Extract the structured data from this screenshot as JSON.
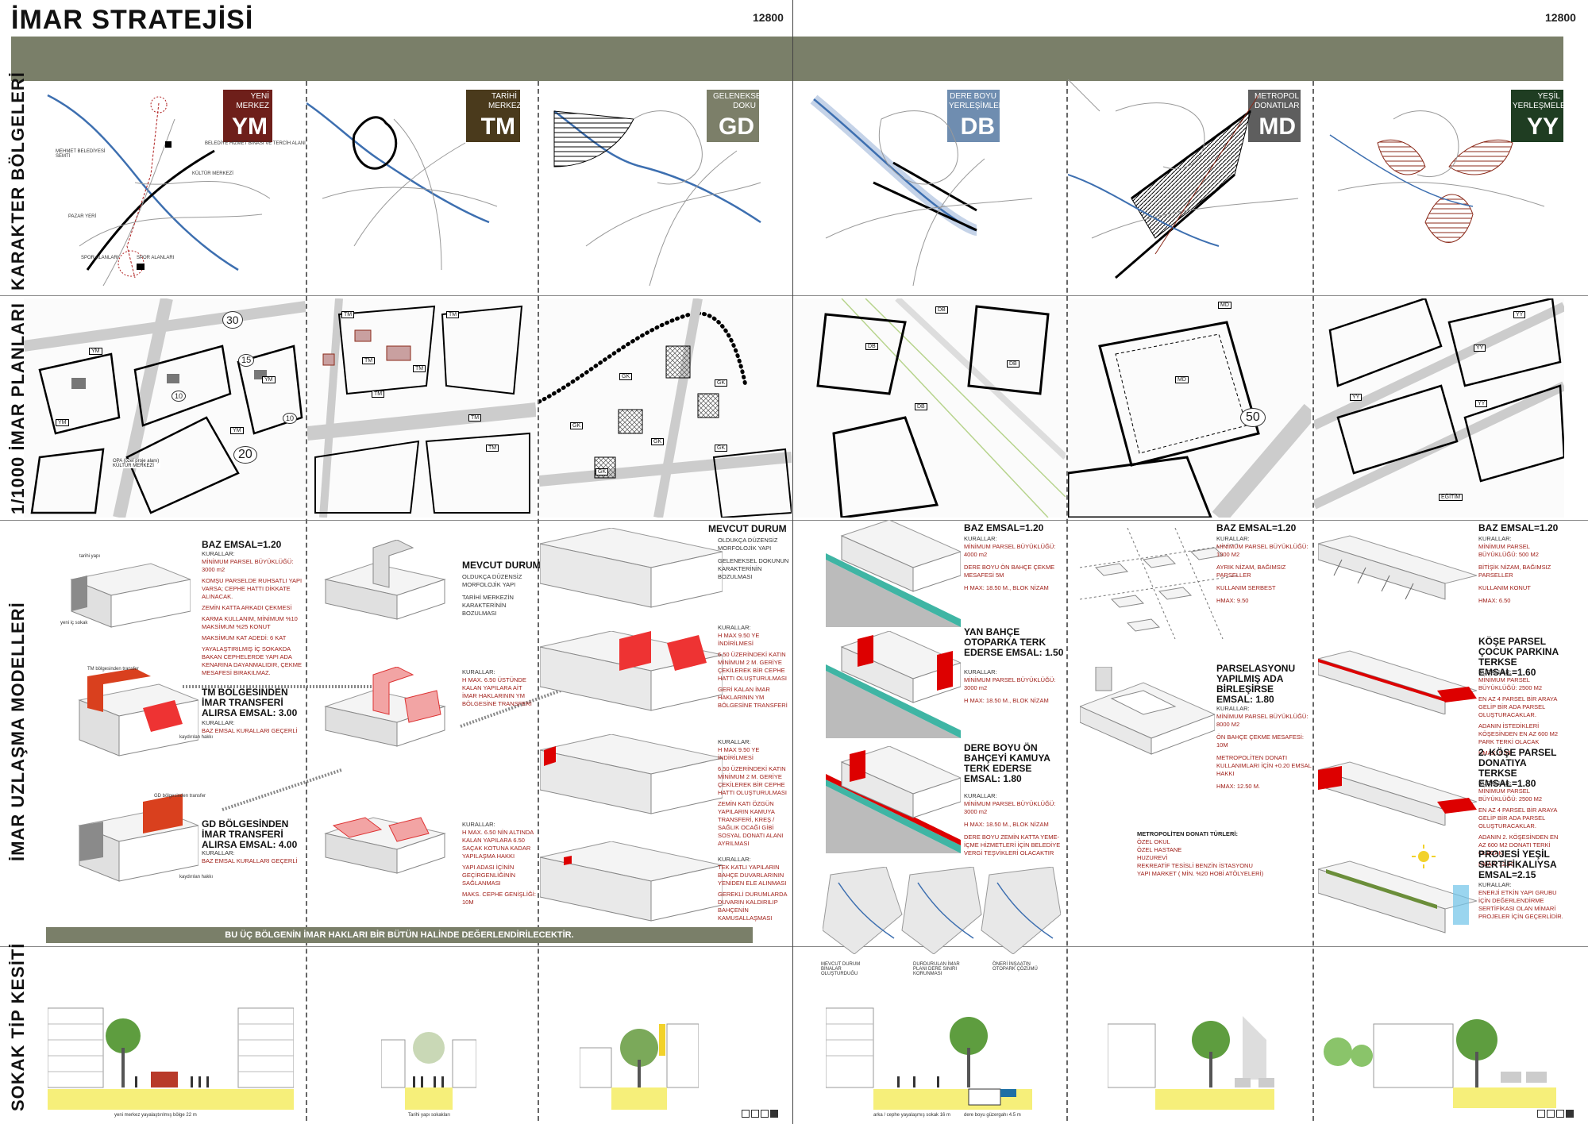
{
  "title": "İMAR STRATEJİSİ",
  "sheet_numbers": [
    "12800",
    "12800"
  ],
  "rows": {
    "r1": "KARAKTER BÖLGELERİ",
    "r2": "1/1000 İMAR PLANLARI",
    "r3": "İMAR UZLAŞMA MODELLERİ",
    "r4": "SOKAK TİP KESİTİ"
  },
  "zones": [
    {
      "small": "YENİ MERKEZ",
      "code": "YM",
      "color": "#6e1f1a"
    },
    {
      "small": "TARİHİ MERKEZ",
      "code": "TM",
      "color": "#4a3a1c"
    },
    {
      "small": "GELENEKSEL DOKU",
      "code": "GD",
      "color": "#7c7f69"
    },
    {
      "small": "DERE BOYU YERLEŞİMLER",
      "code": "DB",
      "color": "#6f8db0"
    },
    {
      "small": "METROPOL DONATILAR",
      "code": "MD",
      "color": "#5e5e5e"
    },
    {
      "small": "YEŞİL YERLEŞMELER",
      "code": "YY",
      "color": "#1f3d22"
    }
  ],
  "ym_map_notes": [
    "BELEDİYE HİZMET BİNASI VE TERCİH ALANI",
    "MEHMET BELEDİYESİ SEMTİ",
    "KÜLTÜR MERKEZİ",
    "PAZAR YERİ",
    "SPOR ALANLARI",
    "SPOR ALANLARI"
  ],
  "plan_labels": {
    "c1": [
      "YM",
      "YM",
      "YM",
      "YM",
      "30",
      "15",
      "10",
      "10",
      "20",
      "OPA (özel proje alanı) KÜLTÜR MERKEZİ"
    ],
    "c2": [
      "TM",
      "TM",
      "TM",
      "TM",
      "TM",
      "TM",
      "TM"
    ],
    "c3": [
      "GK",
      "GK",
      "GK",
      "GK",
      "GK",
      "GK"
    ],
    "c4": [
      "DB",
      "DB",
      "DB",
      "DB"
    ],
    "c5": [
      "MD",
      "MD",
      "50"
    ],
    "c6": [
      "YY",
      "YY",
      "YY",
      "YY",
      "EĞİTİM"
    ]
  },
  "ym": {
    "h1": "BAZ EMSAL=1.20",
    "k1": [
      "KURALLAR:",
      "MİNİMUM PARSEL BÜYÜKLÜĞÜ: 3000 m2",
      "KOMŞU PARSELDE RUHSATLI YAPI VARSA; CEPHE HATTI DİKKATE ALINACAK.",
      "ZEMİN KATTA ARKADI ÇEKMESİ",
      "KARMA KULLANIM, MİNİMUM %10 MAKSİMUM %25 KONUT",
      "MAKSİMUM KAT ADEDİ: 6 KAT",
      "YAYALAŞTIRILMIŞ İÇ SOKAKDA BAKAN CEPHELERDE YAPI ADA KENARINA DAYANMALIDIR, ÇEKME MESAFESİ BIRAKILMAZ."
    ],
    "h2": "TM BÖLGESİNDEN İMAR TRANSFERİ ALIRSA EMSAL: 3.00",
    "k2": [
      "KURALLAR:",
      "BAZ EMSAL KURALLARI GEÇERLİ"
    ],
    "h3": "GD BÖLGESİNDEN İMAR TRANSFERİ ALIRSA EMSAL: 4.00",
    "k3": [
      "KURALLAR:",
      "BAZ EMSAL KURALLARI GEÇERLİ"
    ],
    "notes": [
      "tarihi yapı",
      "yeni iç sokak",
      "TM bölgesinden transfer",
      "kaydırılan hakkı",
      "GD bölgesinden transfer",
      "kaydırılan hakkı"
    ]
  },
  "tm": {
    "h1": "MEVCUT DURUM",
    "k1": [
      "OLDUKÇA DÜZENSİZ MORFOLOJİK YAPI",
      "TARİHİ MERKEZİN KARAKTERİNİN BOZULMASI"
    ],
    "k2": [
      "KURALLAR:",
      "H MAX. 6.50 ÜSTÜNDE KALAN YAPILARA AİT İMAR HAKLARININ YM BÖLGESİNE TRANSFERİ"
    ],
    "k3": [
      "KURALLAR:",
      "H MAX. 6.50 NİN ALTINDA KALAN YAPILARA 6.50 SAÇAK KOTUNA KADAR YAPILAŞMA HAKKI",
      "YAPI ADASI İÇİNİN GEÇİRGENLİĞİNİN SAĞLANMASI",
      "MAKS. CEPHE GENİŞLİĞİ: 10M"
    ]
  },
  "gd": {
    "h1": "MEVCUT DURUM",
    "k1": [
      "OLDUKÇA DÜZENSİZ MORFOLOJİK YAPI",
      "GELENEKSEL DOKUNUN KARAKTERİNİN BOZULMASI"
    ],
    "k2": [
      "KURALLAR:",
      "H MAX 9.50 YE İNDİRİLMESİ",
      "6.50 ÜZERİNDEKİ KATIN MİNİMUM 2 M. GERİYE ÇEKİLEREK BİR CEPHE HATTI OLUŞTURULMASI",
      "GERİ KALAN İMAR HAKLARININ YM BÖLGESİNE TRANSFERİ"
    ],
    "k3": [
      "KURALLAR:",
      "H MAX 9.50 YE İNDİRİLMESİ",
      "6.50 ÜZERİNDEKİ KATIN MİNİMUM 2 M. GERİYE ÇEKİLEREK BİR CEPHE HATTI OLUŞTURULMASI",
      "ZEMİN KATI ÖZGÜN YAPILARIN KAMUYA TRANSFERİ, KREŞ / SAĞLIK OCAĞI GİBİ SOSYAL DONATI ALANI AYRILMASI"
    ],
    "k4": [
      "KURALLAR:",
      "TEK KATLI YAPILARIN BAHÇE DUVARLARININ YENİDEN ELE ALINMASI",
      "GEREKLİ DURUMLARDA DUVARIN KALDIRILIP BAHÇENİN KAMUSALLAŞMASI"
    ]
  },
  "db": {
    "h1": "BAZ EMSAL=1.20",
    "k1": [
      "KURALLAR:",
      "MİNİMUM PARSEL BÜYÜKLÜĞÜ: 4000 m2",
      "DERE BOYU ÖN BAHÇE ÇEKME MESAFESİ 5M",
      "H MAX: 18.50 M., BLOK NİZAM"
    ],
    "h2": "YAN BAHÇE OTOPARKA TERK EDERSE EMSAL: 1.50",
    "k2": [
      "KURALLAR:",
      "MİNİMUM PARSEL BÜYÜKLÜĞÜ: 3000 m2",
      "H MAX: 18.50 M., BLOK NİZAM"
    ],
    "h3": "DERE BOYU ÖN BAHÇEYİ KAMUYA TERK EDERSE EMSAL: 1.80",
    "k3": [
      "KURALLAR:",
      "MİNİMUM PARSEL BÜYÜKLÜĞÜ: 3000 m2",
      "H MAX: 18.50 M., BLOK NİZAM",
      "DERE BOYU ZEMİN KATTA YEME-İÇME HİZMETLERİ İÇİN BELEDİYE VERGİ TEŞVİKLERİ OLACAKTIR"
    ],
    "maps": [
      "MEVCUT DURUM BİNALAR OLUŞTURDUĞU",
      "DURDURULAN İMAR PLANI DERE SINIRI KORUNMASI",
      "ÖNERİ İNŞAATIN OTOPARK ÇÖZÜMÜ"
    ]
  },
  "md": {
    "h1": "BAZ EMSAL=1.20",
    "k1": [
      "KURALLAR:",
      "MİNİMUM PARSEL BÜYÜKLÜĞÜ: 1000 M2",
      "AYRIK NİZAM, BAĞIMSIZ PARSELLER",
      "KULLANIM SERBEST",
      "HMAX: 9.50"
    ],
    "h2": "PARSELASYONU YAPILMIŞ ADA BİRLEŞİRSE EMSAL: 1.80",
    "k2": [
      "KURALLAR:",
      "MİNİMUM PARSEL BÜYÜKLÜĞÜ: 8000 M2",
      "ÖN BAHÇE ÇEKME MESAFESİ: 10M",
      "METROPOLİTEN DONATI KULLANIMLARI İÇİN +0.20 EMSAL HAKKI",
      "HMAX: 12.50 M."
    ],
    "donati_title": "METROPOLİTEN DONATI TÜRLERİ:",
    "donati": [
      "ÖZEL OKUL",
      "ÖZEL HASTANE",
      "HUZUREVİ",
      "REKREATİF TESİSLİ BENZİN İSTASYONU",
      "YAPI MARKET ( MİN. %20 HOBİ ATÖLYELERİ)"
    ]
  },
  "yy": {
    "h1": "BAZ EMSAL=1.20",
    "k1": [
      "KURALLAR:",
      "MİNİMUM PARSEL BÜYÜKLÜĞÜ: 500 M2",
      "BİTİŞİK NİZAM, BAĞIMSIZ PARSELLER",
      "KULLANIM KONUT",
      "HMAX: 6.50"
    ],
    "h2": "KÖŞE PARSEL ÇOCUK PARKINA TERKSE EMSAL=1.60",
    "k2": [
      "KURALLAR:",
      "MİNİMUM PARSEL BÜYÜKLÜĞÜ: 2500 M2",
      "EN AZ 4 PARSEL BİR ARAYA GELİP BİR ADA PARSEL OLUŞTURACAKLAR.",
      "ADANIN İSTEDİKLERİ KÖŞESİNDEN EN AZ 600 M2 PARK TERKİ OLACAK",
      "HMAX: 9.50"
    ],
    "h3": "2. KÖŞE PARSEL DONATIYA TERKSE EMSAL=1.80",
    "k3": [
      "KURALLAR:",
      "MİNİMUM PARSEL BÜYÜKLÜĞÜ: 2500 M2",
      "EN AZ 4 PARSEL BİR ARAYA GELİP BİR ADA PARSEL OLUŞTURACAKLAR.",
      "ADANIN 2. KÖŞESİNDEN EN AZ 600 M2 DONATI TERKİ OLACAK",
      "HMAX: 12.50"
    ],
    "h4": "PROJESİ YEŞİL SERTİFİKALIYSA EMSAL=2.15",
    "k4": [
      "KURALLAR:",
      "ENERJİ ETKİN YAPI GRUBU İÇİN DEĞERLENDİRME SERTİFİKASI OLAN MİMARİ PROJELER İÇİN GEÇERLİDİR."
    ]
  },
  "footer_band": "BU ÜÇ BÖLGENİN İMAR HAKLARI BİR BÜTÜN HALİNDE DEĞERLENDİRİLECEKTİR.",
  "section_captions": [
    "yeni merkez yayalaştırılmış bölge 22 m",
    "Tarihi yapı sokakları",
    "arka / cephe yayalaşmış sokak 16 m",
    "dere boyu güzergahı 4.5 m"
  ]
}
